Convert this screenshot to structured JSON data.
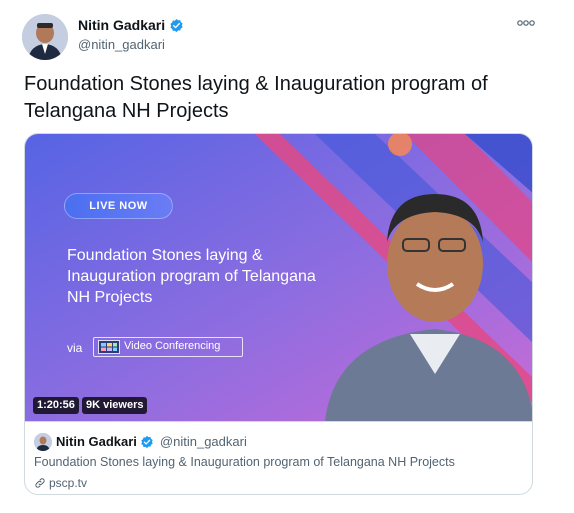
{
  "tweet": {
    "author_name": "Nitin Gadkari",
    "author_handle": "@nitin_gadkari",
    "text": "Foundation Stones laying & Inauguration program of Telangana NH Projects"
  },
  "media": {
    "live_label": "LIVE NOW",
    "title": "Foundation Stones laying & Inauguration program of Telangana NH Projects",
    "via_label": "via",
    "vc_label": "Video Conferencing",
    "duration": "1:20:56",
    "viewers": "9K viewers"
  },
  "card": {
    "author_name": "Nitin Gadkari",
    "author_handle": "@nitin_gadkari",
    "description": "Foundation Stones laying & Inauguration program of Telangana NH Projects",
    "domain": "pscp.tv"
  },
  "colors": {
    "verified": "#1d9bf0",
    "media_gradient_start": "#5b63e0",
    "media_gradient_end": "#c069d6"
  },
  "icons": [
    "verified-badge-icon",
    "more-options-icon",
    "link-icon",
    "video-conferencing-icon"
  ]
}
